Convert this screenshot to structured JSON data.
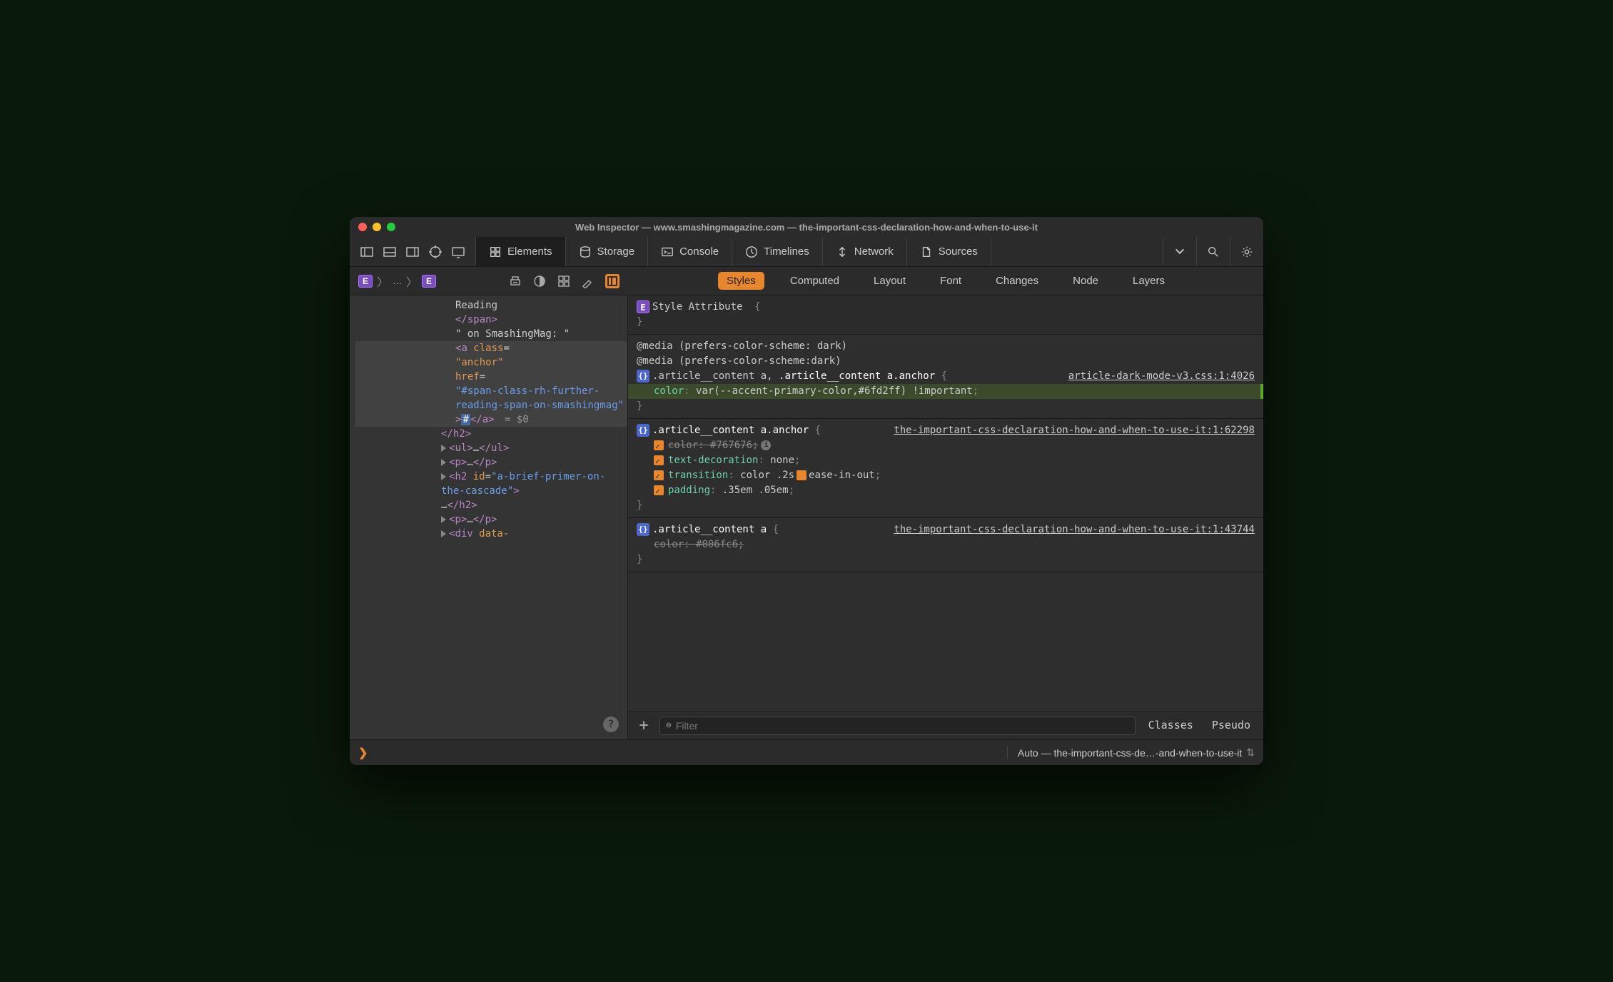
{
  "window_title": "Web Inspector — www.smashingmagazine.com — the-important-css-declaration-how-and-when-to-use-it",
  "tabs": {
    "elements": "Elements",
    "storage": "Storage",
    "console": "Console",
    "timelines": "Timelines",
    "network": "Network",
    "sources": "Sources"
  },
  "breadcrumb_dots": "…",
  "detail_tabs": {
    "styles": "Styles",
    "computed": "Computed",
    "layout": "Layout",
    "font": "Font",
    "changes": "Changes",
    "node": "Node",
    "layers": "Layers"
  },
  "dom": {
    "l1": "Reading",
    "l2a": "</",
    "l2b": "span",
    "l2c": ">",
    "l3": "\" on SmashingMag: \"",
    "l4a": "<",
    "l4b": "a",
    "l4c": " class",
    "l4d": "=",
    "l5": "\"anchor\"",
    "l6a": "href",
    "l6b": "=",
    "l7": "\"#span-class-rh-further-reading-span-on-smashingmag\"",
    "l8a": ">",
    "l8txt": "#",
    "l8b": "</",
    "l8c": "a",
    "l8d": ">",
    "l8e": " = $0",
    "l9a": "</",
    "l9b": "h2",
    "l9c": ">",
    "l10a": "<",
    "l10b": "ul",
    "l10c": ">",
    "l10d": "…",
    "l10e": "</",
    "l10f": "ul",
    "l10g": ">",
    "l11a": "<",
    "l11b": "p",
    "l11c": ">",
    "l11d": "…",
    "l11e": "</",
    "l11f": "p",
    "l11g": ">",
    "l12a": "<",
    "l12b": "h2",
    "l12c": " id",
    "l12d": "=",
    "l12e": "\"a-brief-primer-on-the-cascade\"",
    "l12f": ">",
    "l13a": "…",
    "l13b": "</",
    "l13c": "h2",
    "l13d": ">",
    "l14a": "<",
    "l14b": "p",
    "l14c": ">",
    "l14d": "…",
    "l14e": "</",
    "l14f": "p",
    "l14g": ">",
    "l15a": "<",
    "l15b": "div",
    "l15c": " data-"
  },
  "styles": {
    "style_attr": "Style Attribute",
    "brace_open": "{",
    "brace_close": "}",
    "r1": {
      "media1": "@media (prefers-color-scheme: dark)",
      "media2": "@media (prefers-color-scheme:dark)",
      "sel_a": ".article__content a",
      "sel_comma": ", ",
      "sel_b": ".article__content a.anchor",
      "link": "article-dark-mode-v3.css:1:4026",
      "prop_name": "color",
      "prop_val": "var(--accent-primary-color,#6fd2ff) !important"
    },
    "r2": {
      "sel": ".article__content a.anchor",
      "link": "the-important-css-declaration-how-and-when-to-use-it:1:62298",
      "p1n": "color",
      "p1v": "#767676",
      "p2n": "text-decoration",
      "p2v": "none",
      "p3n": "transition",
      "p3v_a": "color .2s",
      "p3v_b": "ease-in-out",
      "p4n": "padding",
      "p4v": ".35em .05em"
    },
    "r3": {
      "sel": ".article__content a",
      "link": "the-important-css-declaration-how-and-when-to-use-it:1:43744",
      "p1n": "color",
      "p1v": "#006fc6"
    }
  },
  "filter_placeholder": "Filter",
  "footer_classes": "Classes",
  "footer_pseudo": "Pseudo",
  "bottom_context": "Auto — the-important-css-de…-and-when-to-use-it",
  "help": "?"
}
